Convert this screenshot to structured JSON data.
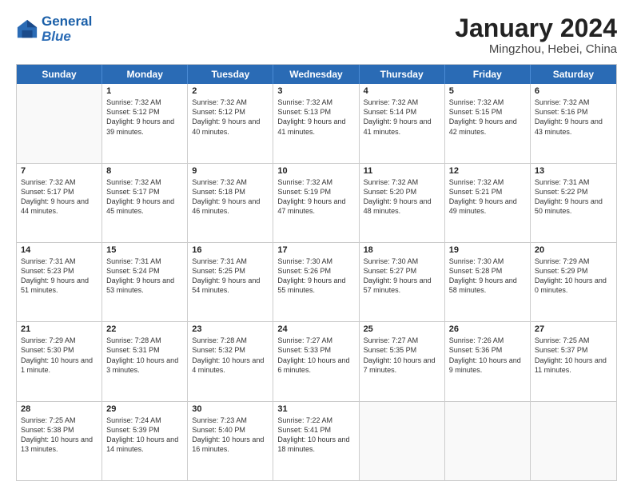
{
  "header": {
    "logo_line1": "General",
    "logo_line2": "Blue",
    "month_year": "January 2024",
    "location": "Mingzhou, Hebei, China"
  },
  "weekdays": [
    "Sunday",
    "Monday",
    "Tuesday",
    "Wednesday",
    "Thursday",
    "Friday",
    "Saturday"
  ],
  "weeks": [
    [
      {
        "day": "",
        "sunrise": "",
        "sunset": "",
        "daylight": ""
      },
      {
        "day": "1",
        "sunrise": "Sunrise: 7:32 AM",
        "sunset": "Sunset: 5:12 PM",
        "daylight": "Daylight: 9 hours and 39 minutes."
      },
      {
        "day": "2",
        "sunrise": "Sunrise: 7:32 AM",
        "sunset": "Sunset: 5:12 PM",
        "daylight": "Daylight: 9 hours and 40 minutes."
      },
      {
        "day": "3",
        "sunrise": "Sunrise: 7:32 AM",
        "sunset": "Sunset: 5:13 PM",
        "daylight": "Daylight: 9 hours and 41 minutes."
      },
      {
        "day": "4",
        "sunrise": "Sunrise: 7:32 AM",
        "sunset": "Sunset: 5:14 PM",
        "daylight": "Daylight: 9 hours and 41 minutes."
      },
      {
        "day": "5",
        "sunrise": "Sunrise: 7:32 AM",
        "sunset": "Sunset: 5:15 PM",
        "daylight": "Daylight: 9 hours and 42 minutes."
      },
      {
        "day": "6",
        "sunrise": "Sunrise: 7:32 AM",
        "sunset": "Sunset: 5:16 PM",
        "daylight": "Daylight: 9 hours and 43 minutes."
      }
    ],
    [
      {
        "day": "7",
        "sunrise": "Sunrise: 7:32 AM",
        "sunset": "Sunset: 5:17 PM",
        "daylight": "Daylight: 9 hours and 44 minutes."
      },
      {
        "day": "8",
        "sunrise": "Sunrise: 7:32 AM",
        "sunset": "Sunset: 5:17 PM",
        "daylight": "Daylight: 9 hours and 45 minutes."
      },
      {
        "day": "9",
        "sunrise": "Sunrise: 7:32 AM",
        "sunset": "Sunset: 5:18 PM",
        "daylight": "Daylight: 9 hours and 46 minutes."
      },
      {
        "day": "10",
        "sunrise": "Sunrise: 7:32 AM",
        "sunset": "Sunset: 5:19 PM",
        "daylight": "Daylight: 9 hours and 47 minutes."
      },
      {
        "day": "11",
        "sunrise": "Sunrise: 7:32 AM",
        "sunset": "Sunset: 5:20 PM",
        "daylight": "Daylight: 9 hours and 48 minutes."
      },
      {
        "day": "12",
        "sunrise": "Sunrise: 7:32 AM",
        "sunset": "Sunset: 5:21 PM",
        "daylight": "Daylight: 9 hours and 49 minutes."
      },
      {
        "day": "13",
        "sunrise": "Sunrise: 7:31 AM",
        "sunset": "Sunset: 5:22 PM",
        "daylight": "Daylight: 9 hours and 50 minutes."
      }
    ],
    [
      {
        "day": "14",
        "sunrise": "Sunrise: 7:31 AM",
        "sunset": "Sunset: 5:23 PM",
        "daylight": "Daylight: 9 hours and 51 minutes."
      },
      {
        "day": "15",
        "sunrise": "Sunrise: 7:31 AM",
        "sunset": "Sunset: 5:24 PM",
        "daylight": "Daylight: 9 hours and 53 minutes."
      },
      {
        "day": "16",
        "sunrise": "Sunrise: 7:31 AM",
        "sunset": "Sunset: 5:25 PM",
        "daylight": "Daylight: 9 hours and 54 minutes."
      },
      {
        "day": "17",
        "sunrise": "Sunrise: 7:30 AM",
        "sunset": "Sunset: 5:26 PM",
        "daylight": "Daylight: 9 hours and 55 minutes."
      },
      {
        "day": "18",
        "sunrise": "Sunrise: 7:30 AM",
        "sunset": "Sunset: 5:27 PM",
        "daylight": "Daylight: 9 hours and 57 minutes."
      },
      {
        "day": "19",
        "sunrise": "Sunrise: 7:30 AM",
        "sunset": "Sunset: 5:28 PM",
        "daylight": "Daylight: 9 hours and 58 minutes."
      },
      {
        "day": "20",
        "sunrise": "Sunrise: 7:29 AM",
        "sunset": "Sunset: 5:29 PM",
        "daylight": "Daylight: 10 hours and 0 minutes."
      }
    ],
    [
      {
        "day": "21",
        "sunrise": "Sunrise: 7:29 AM",
        "sunset": "Sunset: 5:30 PM",
        "daylight": "Daylight: 10 hours and 1 minute."
      },
      {
        "day": "22",
        "sunrise": "Sunrise: 7:28 AM",
        "sunset": "Sunset: 5:31 PM",
        "daylight": "Daylight: 10 hours and 3 minutes."
      },
      {
        "day": "23",
        "sunrise": "Sunrise: 7:28 AM",
        "sunset": "Sunset: 5:32 PM",
        "daylight": "Daylight: 10 hours and 4 minutes."
      },
      {
        "day": "24",
        "sunrise": "Sunrise: 7:27 AM",
        "sunset": "Sunset: 5:33 PM",
        "daylight": "Daylight: 10 hours and 6 minutes."
      },
      {
        "day": "25",
        "sunrise": "Sunrise: 7:27 AM",
        "sunset": "Sunset: 5:35 PM",
        "daylight": "Daylight: 10 hours and 7 minutes."
      },
      {
        "day": "26",
        "sunrise": "Sunrise: 7:26 AM",
        "sunset": "Sunset: 5:36 PM",
        "daylight": "Daylight: 10 hours and 9 minutes."
      },
      {
        "day": "27",
        "sunrise": "Sunrise: 7:25 AM",
        "sunset": "Sunset: 5:37 PM",
        "daylight": "Daylight: 10 hours and 11 minutes."
      }
    ],
    [
      {
        "day": "28",
        "sunrise": "Sunrise: 7:25 AM",
        "sunset": "Sunset: 5:38 PM",
        "daylight": "Daylight: 10 hours and 13 minutes."
      },
      {
        "day": "29",
        "sunrise": "Sunrise: 7:24 AM",
        "sunset": "Sunset: 5:39 PM",
        "daylight": "Daylight: 10 hours and 14 minutes."
      },
      {
        "day": "30",
        "sunrise": "Sunrise: 7:23 AM",
        "sunset": "Sunset: 5:40 PM",
        "daylight": "Daylight: 10 hours and 16 minutes."
      },
      {
        "day": "31",
        "sunrise": "Sunrise: 7:22 AM",
        "sunset": "Sunset: 5:41 PM",
        "daylight": "Daylight: 10 hours and 18 minutes."
      },
      {
        "day": "",
        "sunrise": "",
        "sunset": "",
        "daylight": ""
      },
      {
        "day": "",
        "sunrise": "",
        "sunset": "",
        "daylight": ""
      },
      {
        "day": "",
        "sunrise": "",
        "sunset": "",
        "daylight": ""
      }
    ]
  ]
}
